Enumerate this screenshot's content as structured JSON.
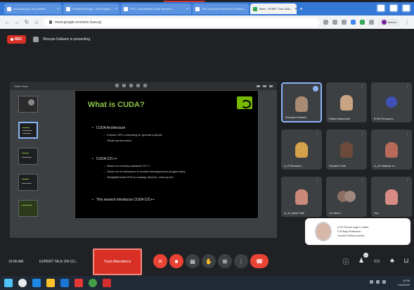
{
  "browser": {
    "tabs": [
      {
        "label": "Accounting for an parallel ..."
      },
      {
        "label": "NirmitiExchange - Next Engine..."
      },
      {
        "label": "PDC, Experiential Cloud Services..."
      },
      {
        "label": "PDC Advanced Network Solutions..."
      },
      {
        "label": "Meet - NTMF7 Tool GDD..."
      }
    ],
    "url": "meet.google.com/wnc-fyao-jvj",
    "profile_label": "Mentor"
  },
  "meet": {
    "rec_label": "REC",
    "presenting_text": "Shreyas Kulkarni is presenting",
    "clock": "10:06 AM",
    "meeting_name": "EXPERT TALK ON CU...",
    "track_button": "Track Attendance"
  },
  "presentation": {
    "window_title": "Slide Show",
    "slide": {
      "title": "What is CUDA?",
      "bullets": [
        {
          "text": "CUDA Architecture",
          "subs": [
            "Expose GPU computing for general purpose",
            "Retain performance"
          ]
        },
        {
          "text": "CUDA C/C++",
          "subs": [
            "Based on industry-standard C/C++",
            "Small set of extensions to enable heterogeneous programming",
            "Straightforward APIs to manage devices, memory etc."
          ]
        },
        {
          "text": "This session introduces CUDA C/C++",
          "subs": []
        }
      ]
    }
  },
  "participants": [
    {
      "name": "Shreyas Kulkarni"
    },
    {
      "name": "Rakhe Mayuresh"
    },
    {
      "name": "B.Shi Shreya A..."
    },
    {
      "name": "A_R Bhushan..."
    },
    {
      "name": "Rishabh Patil"
    },
    {
      "name": "A_32 Madhav m..."
    },
    {
      "name": "A_of_Aakik Patil"
    },
    {
      "name": "13 others"
    },
    {
      "name": "You"
    }
  ],
  "notification": {
    "lines": [
      "A 32 Rohan ragh Londhe",
      "S.B Bapi Rasoolon",
      "Srushti Rathod joined"
    ]
  },
  "taskbar": {
    "time": "10:06",
    "date": "1/11/2022"
  },
  "colors": {
    "accent": "#1a73e8",
    "record_red": "#d93025",
    "meet_bg": "#202124",
    "slide_title_green": "#8bc34a"
  }
}
